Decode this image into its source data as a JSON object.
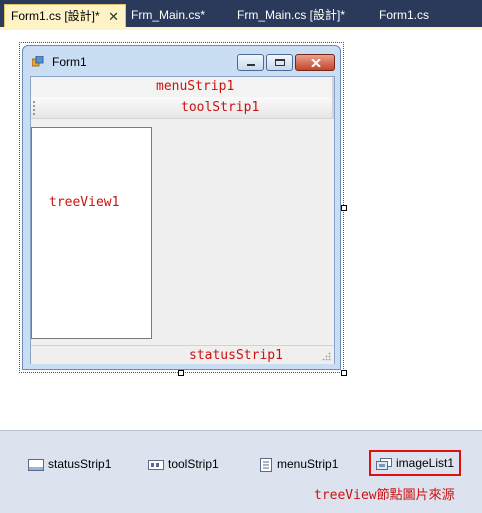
{
  "tabs": [
    {
      "label": "Form1.cs [設計]*",
      "active": true
    },
    {
      "label": "Frm_Main.cs*"
    },
    {
      "label": "Frm_Main.cs [設計]*"
    },
    {
      "label": "Form1.cs"
    }
  ],
  "tab_close_glyph": "✕",
  "form": {
    "title": "Form1",
    "controls": {
      "menustrip": "menuStrip1",
      "toolstrip": "toolStrip1",
      "treeview": "treeView1",
      "statusstrip": "statusStrip1"
    }
  },
  "tray": {
    "items": [
      {
        "label": "statusStrip1",
        "icon": "statusstrip-icon"
      },
      {
        "label": "toolStrip1",
        "icon": "toolstrip-icon"
      },
      {
        "label": "menuStrip1",
        "icon": "menustrip-icon"
      },
      {
        "label": "imageList1",
        "icon": "imagelist-icon",
        "highlighted": true
      }
    ],
    "annotation": "treeView節點圖片來源"
  },
  "colors": {
    "tab_bar": "#2b3a5a",
    "active_tab": "#fdf3c7",
    "annotation_red": "#cc1111",
    "highlight_border": "#e01010"
  }
}
